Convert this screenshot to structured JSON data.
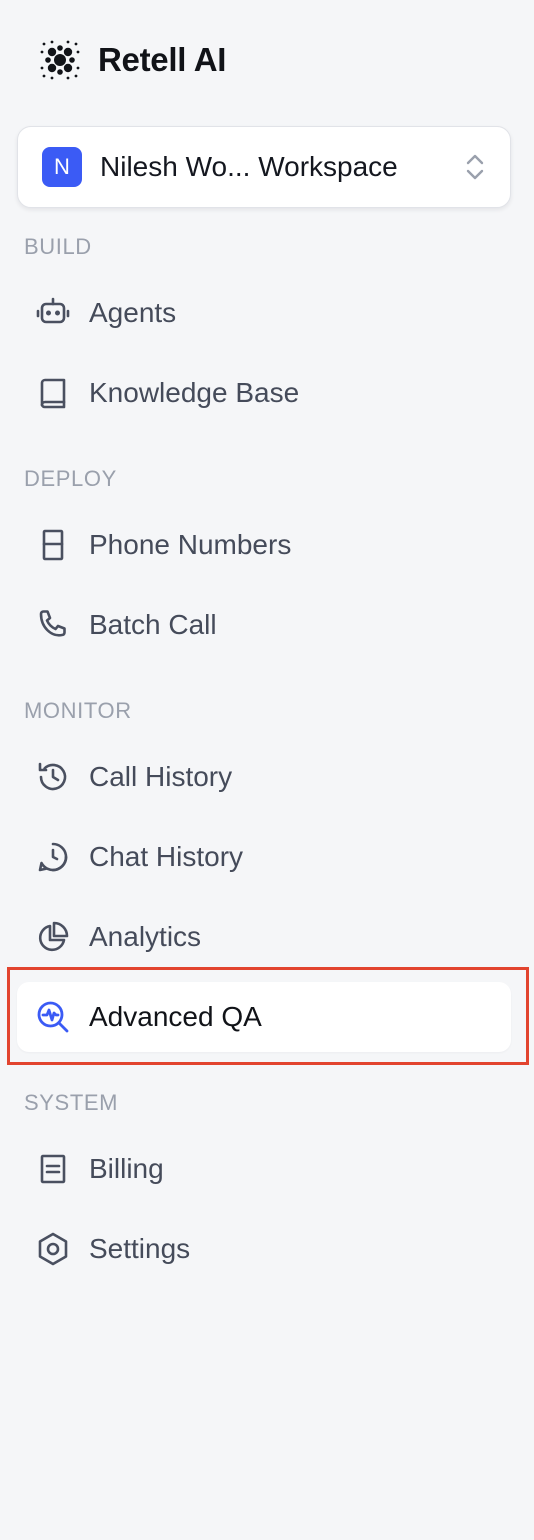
{
  "brand": {
    "name": "Retell AI",
    "logo_icon": "retell-logo-icon"
  },
  "workspace": {
    "avatar_letter": "N",
    "name": "Nilesh Wo... Workspace",
    "avatar_color": "#3b5bf5"
  },
  "sections": {
    "build": "BUILD",
    "deploy": "DEPLOY",
    "monitor": "MONITOR",
    "system": "SYSTEM"
  },
  "nav": {
    "agents": {
      "label": "Agents",
      "icon": "robot-icon"
    },
    "knowledge_base": {
      "label": "Knowledge Base",
      "icon": "book-icon"
    },
    "phone_numbers": {
      "label": "Phone Numbers",
      "icon": "phone-number-icon"
    },
    "batch_call": {
      "label": "Batch Call",
      "icon": "phone-icon"
    },
    "call_history": {
      "label": "Call History",
      "icon": "history-icon"
    },
    "chat_history": {
      "label": "Chat History",
      "icon": "chat-clock-icon"
    },
    "analytics": {
      "label": "Analytics",
      "icon": "pie-chart-icon"
    },
    "advanced_qa": {
      "label": "Advanced QA",
      "icon": "search-pulse-icon",
      "active": true
    },
    "billing": {
      "label": "Billing",
      "icon": "receipt-icon"
    },
    "settings": {
      "label": "Settings",
      "icon": "settings-hex-icon"
    }
  },
  "colors": {
    "accent": "#3b5bf5",
    "highlight": "#e2442f",
    "background": "#f5f6f8"
  }
}
